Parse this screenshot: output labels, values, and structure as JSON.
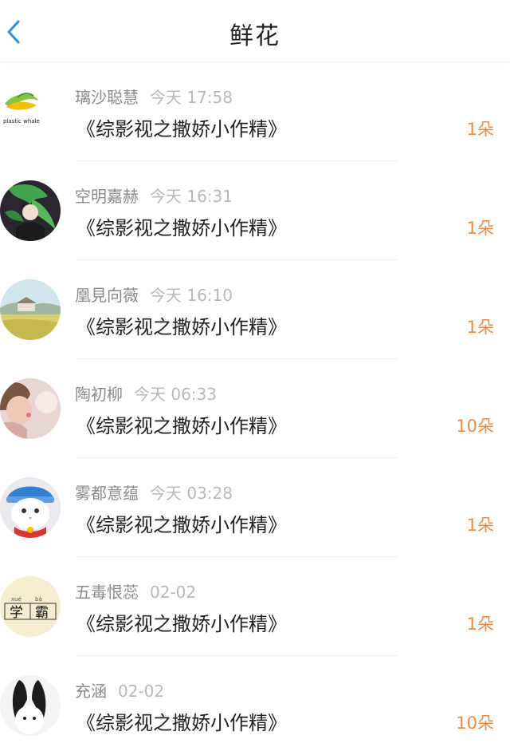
{
  "header": {
    "title": "鲜花"
  },
  "items": [
    {
      "name": "璃沙聪慧",
      "time": "今天 17:58",
      "title": "《综影视之撒娇小作精》",
      "count": "1朵",
      "avatar_icon": "plastic-whale-logo-avatar",
      "avatar_text": "plastic whale"
    },
    {
      "name": "空明嘉赫",
      "time": "今天 16:31",
      "title": "《综影视之撒娇小作精》",
      "count": "1朵",
      "avatar_icon": "green-hair-anime-avatar"
    },
    {
      "name": "凰見向薇",
      "time": "今天 16:10",
      "title": "《综影视之撒娇小作精》",
      "count": "1朵",
      "avatar_icon": "landscape-avatar"
    },
    {
      "name": "陶初柳",
      "time": "今天 06:33",
      "title": "《综影视之撒娇小作精》",
      "count": "10朵",
      "avatar_icon": "girl-dandelion-avatar"
    },
    {
      "name": "雾都意蕴",
      "time": "今天 03:28",
      "title": "《综影视之撒娇小作精》",
      "count": "1朵",
      "avatar_icon": "cat-blue-hat-avatar"
    },
    {
      "name": "五毒恨蕊",
      "time": "02-02",
      "title": "《综影视之撒娇小作精》",
      "count": "1朵",
      "avatar_icon": "xueba-avatar",
      "avatar_chars": [
        "学",
        "霸"
      ],
      "avatar_pinyin": [
        "xué",
        "bà"
      ]
    },
    {
      "name": "充涵",
      "time": "02-02",
      "title": "《综影视之撒娇小作精》",
      "count": "10朵",
      "avatar_icon": "rabbit-avatar"
    }
  ],
  "colors": {
    "accent": "#f08a3c",
    "back": "#2d8cf0",
    "name": "#8a8a8a",
    "time": "#b8b8b8"
  }
}
